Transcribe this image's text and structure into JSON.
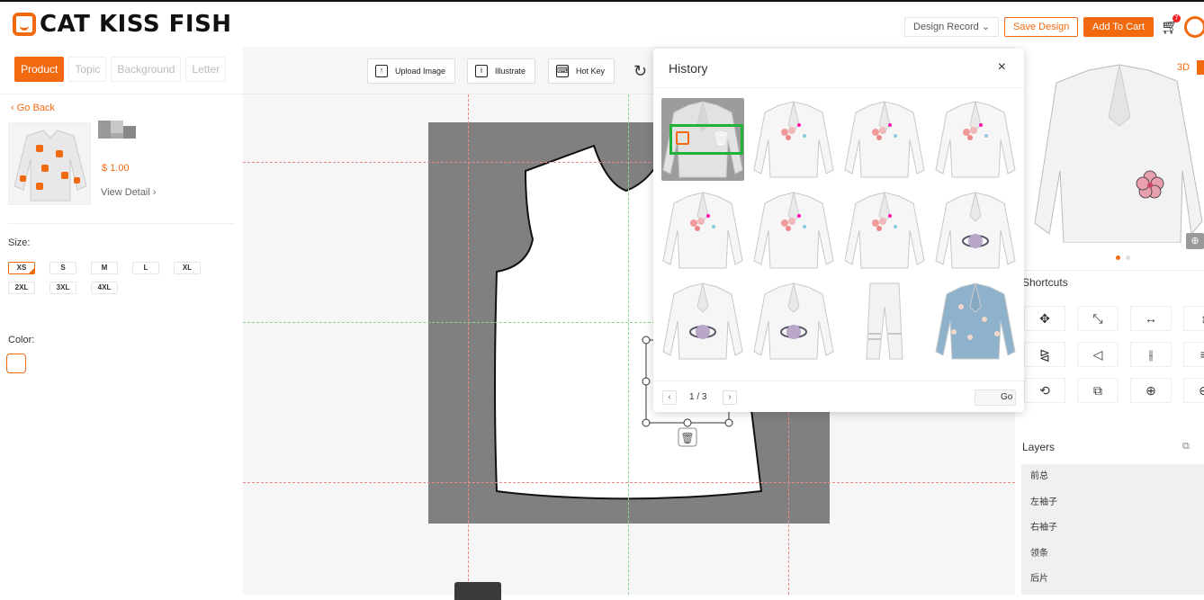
{
  "header": {
    "logo_text": "CAT KISS FISH",
    "design_record_label": "Design Record",
    "save_design_label": "Save Design",
    "add_to_cart_label": "Add To Cart",
    "cart_badge": "7"
  },
  "left": {
    "tabs": [
      {
        "label": "Product",
        "active": true
      },
      {
        "label": "Topic",
        "active": false
      },
      {
        "label": "Background",
        "active": false
      },
      {
        "label": "Letter",
        "active": false
      }
    ],
    "go_back": "Go Back",
    "price": "$ 1.00",
    "view_detail": "View Detail",
    "size_label": "Size:",
    "sizes": [
      "XS",
      "S",
      "M",
      "L",
      "XL",
      "2XL",
      "3XL",
      "4XL"
    ],
    "selected_size": "XS",
    "color_label": "Color:"
  },
  "toolbar": {
    "upload_label": "Upload Image",
    "illustrate_label": "Illustrate",
    "hotkey_label": "Hot Key"
  },
  "history": {
    "title": "History",
    "page_text": "1 / 3",
    "go_label": "Go",
    "thumbnails": [
      "shirt",
      "shirt-flowers",
      "shirt-flowers",
      "shirt-flowers",
      "shirt-flowers",
      "shirt-flowers",
      "shirt-flowers",
      "shirt-planet",
      "shirt-planet",
      "shirt-planet",
      "pants",
      "shirt-blue-floral"
    ]
  },
  "right": {
    "view_3d": "3D",
    "shortcuts_title": "Shortcuts",
    "layers_title": "Layers",
    "layers": [
      "前总",
      "左袖子",
      "右袖子",
      "领条",
      "后片"
    ]
  },
  "colors": {
    "accent": "#f26a10",
    "highlight": "#1fb33a",
    "canvas_bg": "#808080"
  }
}
